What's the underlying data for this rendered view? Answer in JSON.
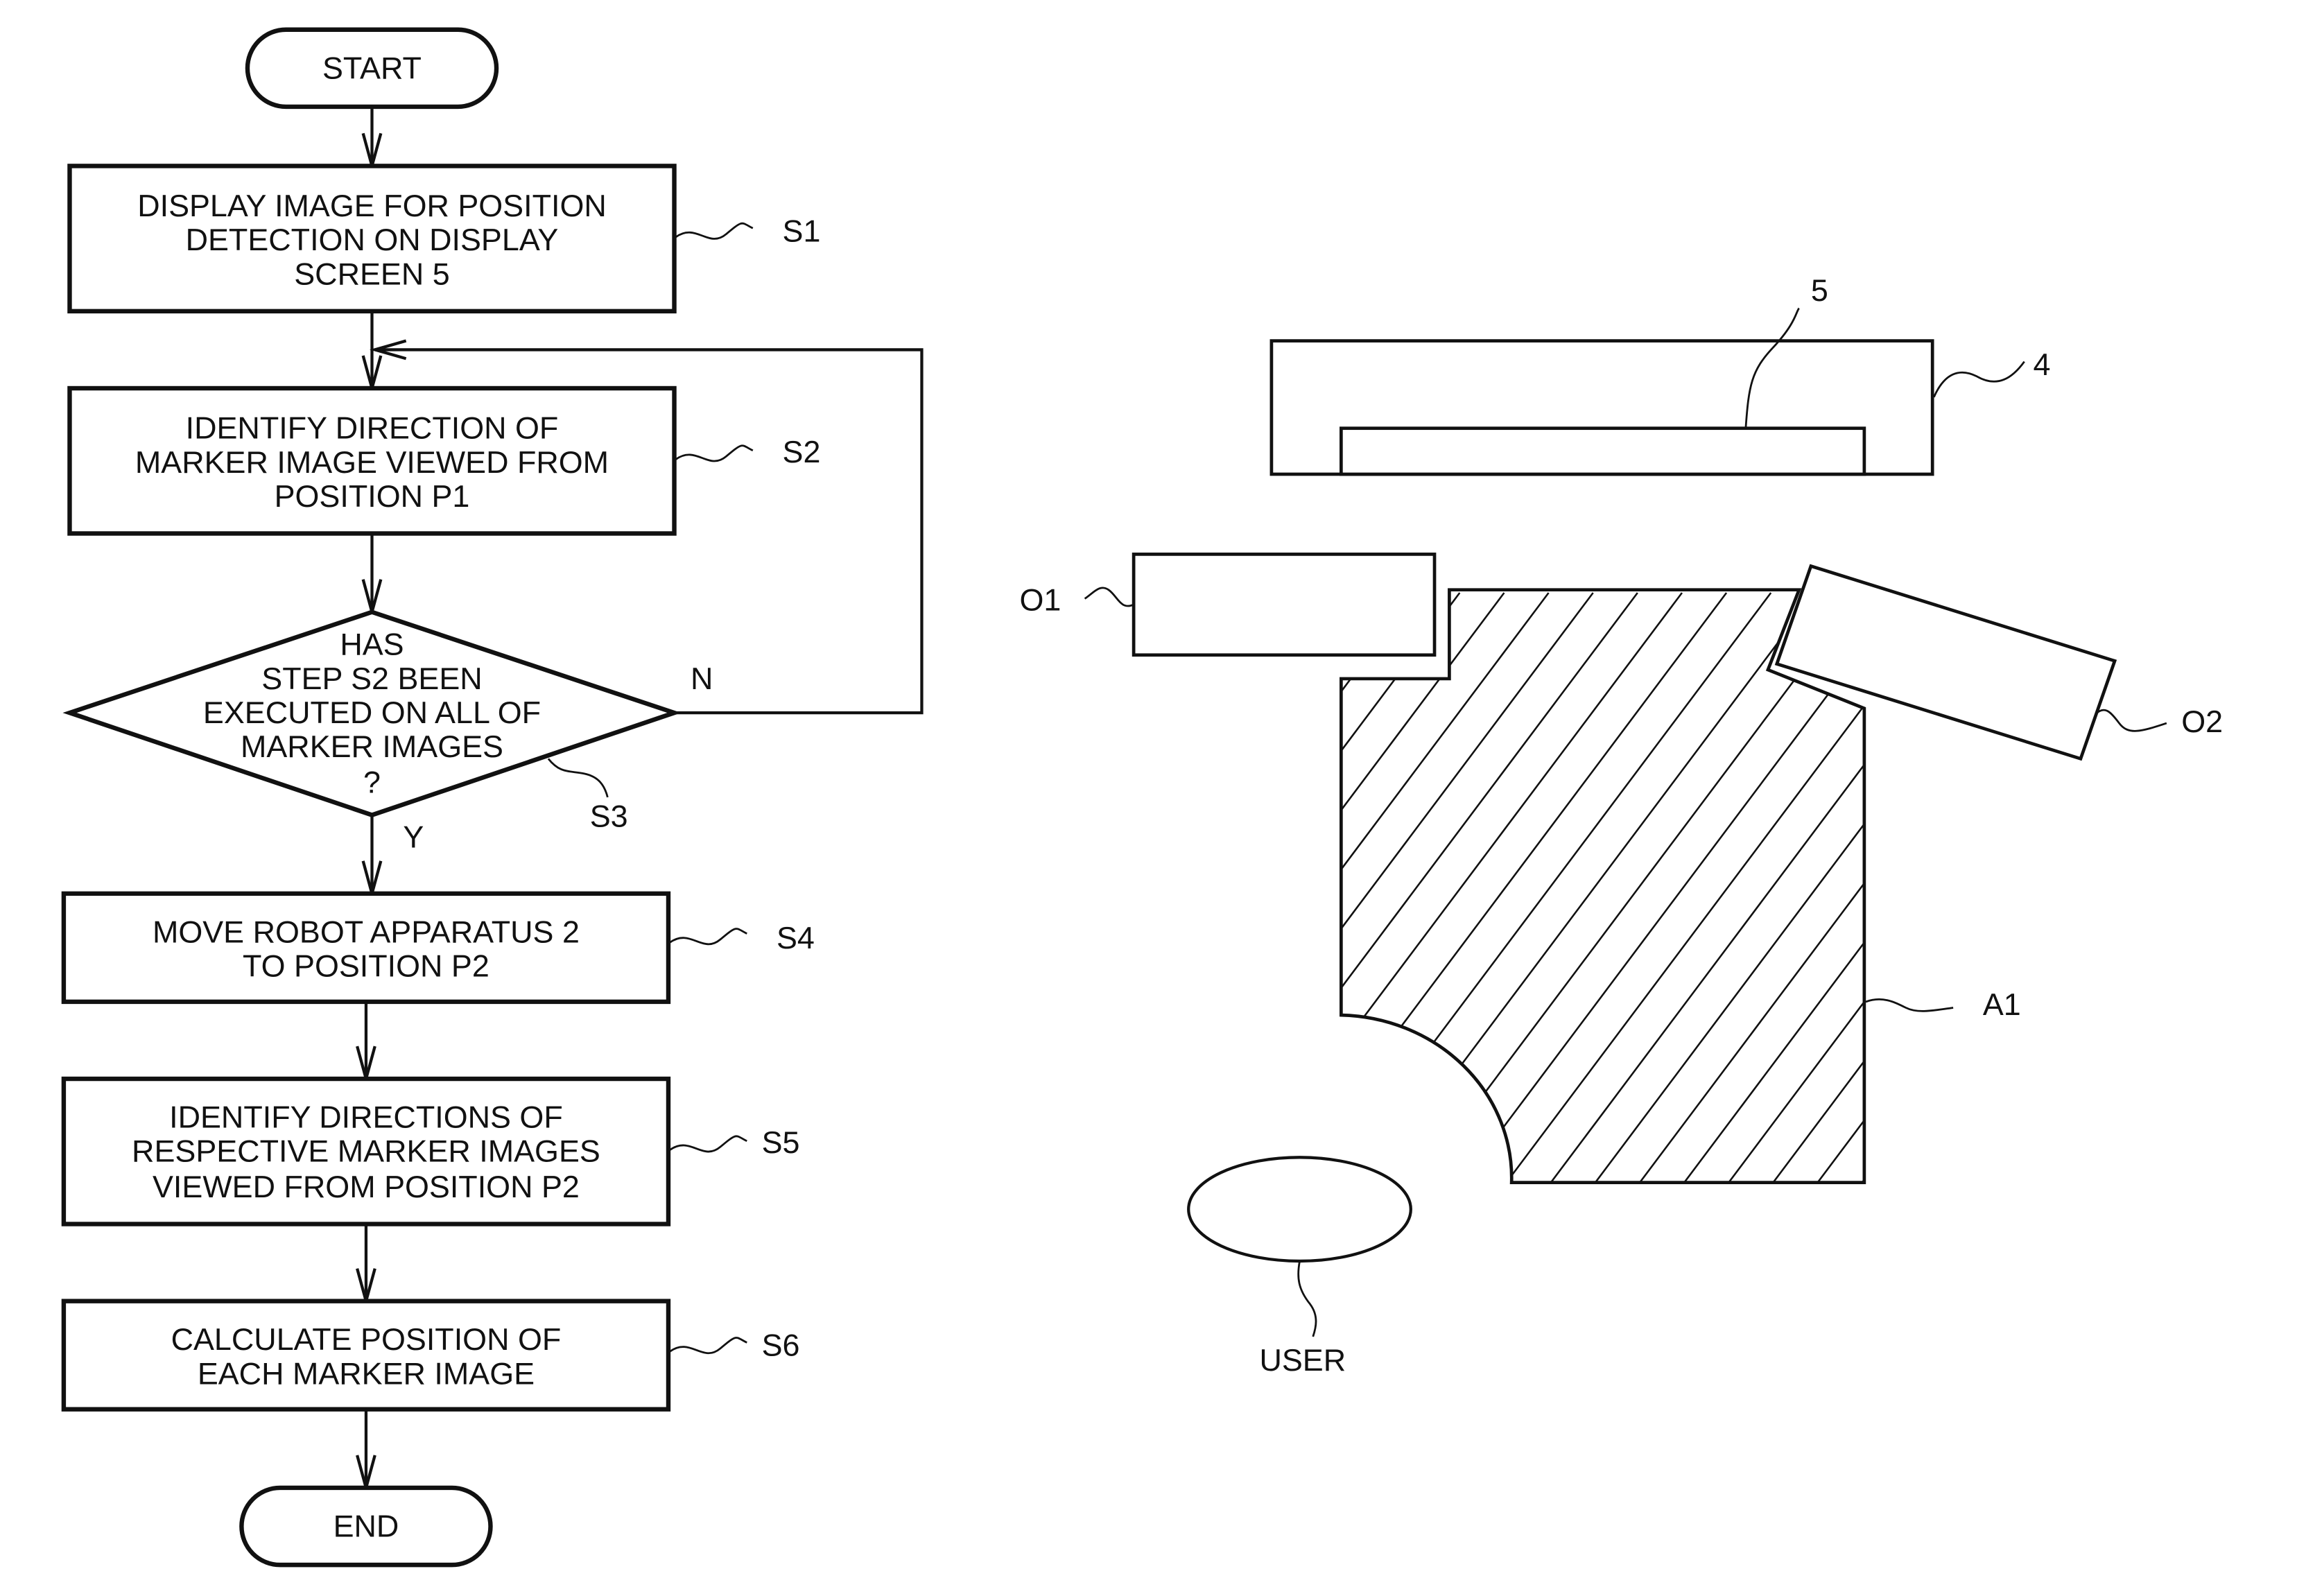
{
  "flowchart": {
    "start": "START",
    "end": "END",
    "steps": [
      {
        "id": "S1",
        "lines": [
          "DISPLAY IMAGE FOR POSITION",
          "DETECTION ON DISPLAY",
          "SCREEN 5"
        ]
      },
      {
        "id": "S2",
        "lines": [
          "IDENTIFY DIRECTION OF",
          "MARKER IMAGE VIEWED FROM",
          "POSITION P1"
        ]
      },
      {
        "id": "S3",
        "lines": [
          "HAS",
          "STEP S2 BEEN",
          "EXECUTED ON ALL OF",
          "MARKER IMAGES",
          "?"
        ]
      },
      {
        "id": "S4",
        "lines": [
          "MOVE ROBOT APPARATUS 2",
          "TO POSITION P2"
        ]
      },
      {
        "id": "S5",
        "lines": [
          "IDENTIFY DIRECTIONS OF",
          "RESPECTIVE MARKER IMAGES",
          "VIEWED FROM POSITION P2"
        ]
      },
      {
        "id": "S6",
        "lines": [
          "CALCULATE POSITION OF",
          "EACH MARKER IMAGE"
        ]
      }
    ],
    "decision_no": "N",
    "decision_yes": "Y"
  },
  "layout_diagram": {
    "labels": {
      "screen": "5",
      "display_device": "4",
      "obstacle_1": "O1",
      "obstacle_2": "O2",
      "area": "A1",
      "user": "USER"
    }
  }
}
